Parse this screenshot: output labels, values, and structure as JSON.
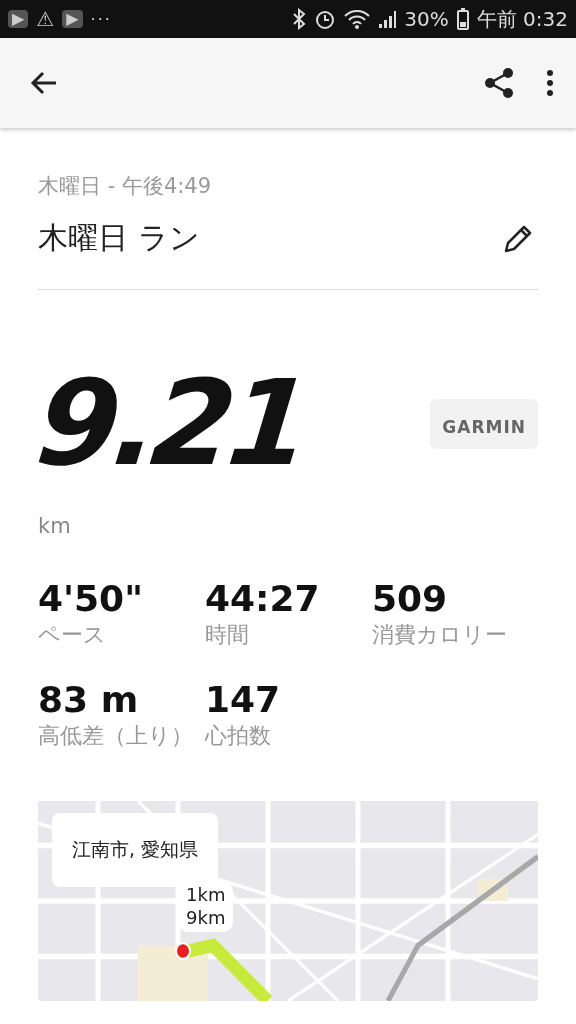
{
  "status_bar": {
    "notifications": [
      "▶",
      "⚠",
      "▶"
    ],
    "more": "···",
    "battery": "30%",
    "time": "午前 0:32"
  },
  "date": "木曜日 - 午後4:49",
  "title": "木曜日 ラン",
  "distance": {
    "value": "9.21",
    "unit": "km"
  },
  "source_logo": "GARMIN",
  "stats": [
    {
      "value": "4'50\"",
      "label": "ペース"
    },
    {
      "value": "44:27",
      "label": "時間"
    },
    {
      "value": "509",
      "label": "消費カロリー"
    },
    {
      "value": "83 m",
      "label": "高低差（上り）"
    },
    {
      "value": "147",
      "label": "心拍数"
    }
  ],
  "map": {
    "location": "江南市, 愛知県",
    "markers": [
      "1km",
      "9km"
    ]
  }
}
